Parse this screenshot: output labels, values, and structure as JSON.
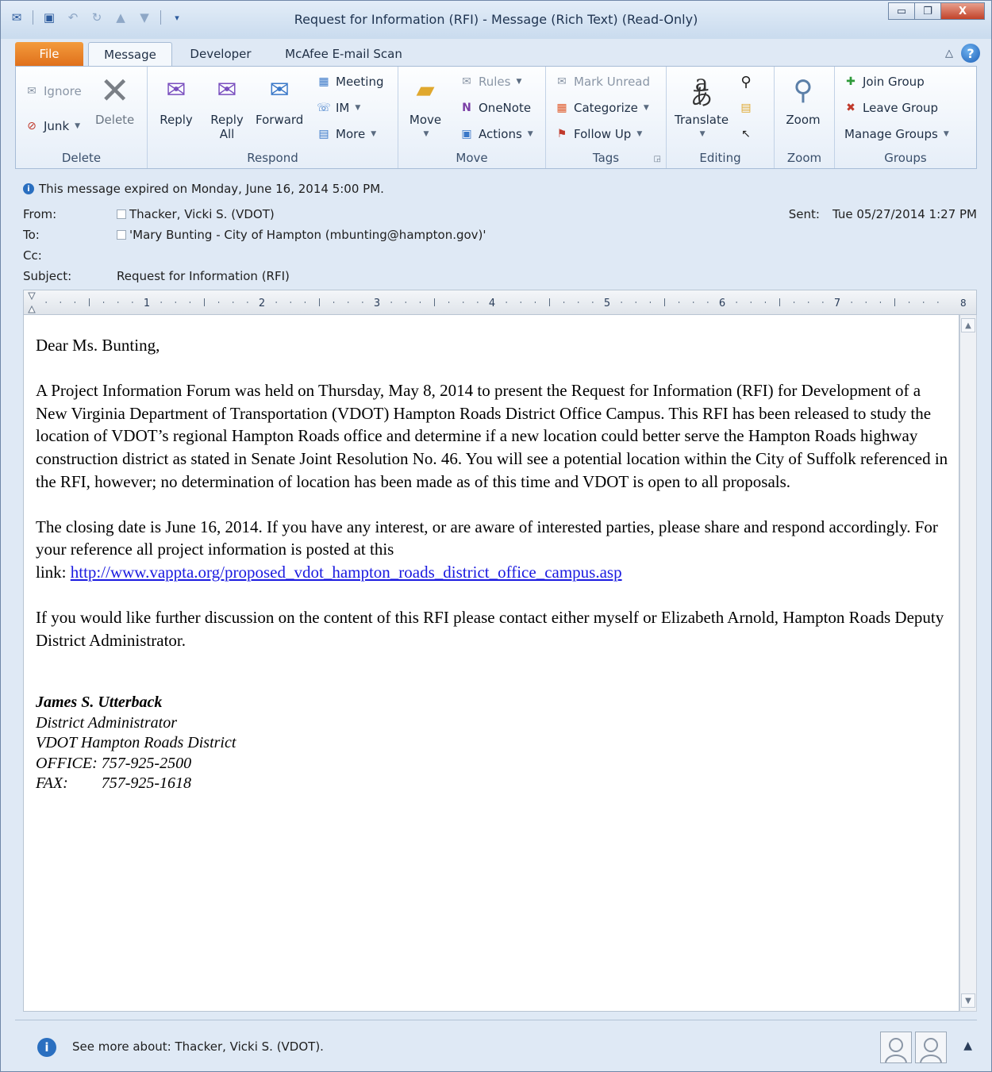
{
  "window": {
    "title": "Request for Information (RFI)  -  Message (Rich Text) (Read-Only)",
    "minimize": "▭",
    "restore": "❐",
    "close": "X"
  },
  "tabs": {
    "file": "File",
    "message": "Message",
    "developer": "Developer",
    "mcafee": "McAfee E-mail Scan",
    "help": "?"
  },
  "ribbon": {
    "delete_group": {
      "ignore": "Ignore",
      "junk": "Junk",
      "delete": "Delete",
      "label": "Delete"
    },
    "respond_group": {
      "reply": "Reply",
      "reply_all_1": "Reply",
      "reply_all_2": "All",
      "forward": "Forward",
      "meeting": "Meeting",
      "im": "IM",
      "more": "More",
      "label": "Respond"
    },
    "move_group": {
      "move": "Move",
      "rules": "Rules",
      "onenote": "OneNote",
      "actions": "Actions",
      "label": "Move"
    },
    "tags_group": {
      "mark_unread": "Mark Unread",
      "categorize": "Categorize",
      "follow_up": "Follow Up",
      "label": "Tags"
    },
    "editing_group": {
      "translate": "Translate",
      "label": "Editing"
    },
    "zoom_group": {
      "zoom": "Zoom",
      "label": "Zoom"
    },
    "groups_group": {
      "join": "Join Group",
      "leave": "Leave Group",
      "manage": "Manage Groups",
      "label": "Groups"
    }
  },
  "header": {
    "info": "This message expired on Monday, June 16, 2014 5:00 PM.",
    "from_label": "From:",
    "from_value": "Thacker, Vicki S. (VDOT)",
    "to_label": "To:",
    "to_value": "'Mary Bunting - City of Hampton (mbunting@hampton.gov)'",
    "cc_label": "Cc:",
    "subject_label": "Subject:",
    "subject_value": "Request for Information (RFI)",
    "sent_label": "Sent:",
    "sent_value": "Tue 05/27/2014 1:27 PM"
  },
  "ruler": {
    "marks": [
      "1",
      "2",
      "3",
      "4",
      "5",
      "6",
      "7"
    ],
    "end_mark": "8"
  },
  "body": {
    "greeting": "Dear Ms. Bunting,",
    "para1": "A Project Information Forum was held on Thursday, May 8, 2014 to present the Request for Information (RFI) for Development of a New Virginia Department of Transportation (VDOT) Hampton Roads District Office Campus.  This RFI has been released to study the location of VDOT’s regional Hampton Roads office and determine if a new location could better serve the Hampton Roads highway construction district as stated in Senate Joint Resolution No. 46.  You will see a potential location within the City of Suffolk referenced in the RFI, however; no determination of location has been made as of this time and VDOT is open to all proposals.",
    "para2": "The closing date is June 16, 2014.  If you have any interest, or are aware of interested parties, please share and respond accordingly.  For your reference all project information is posted at this",
    "link_prefix": "link:  ",
    "link": "http://www.vappta.org/proposed_vdot_hampton_roads_district_office_campus.asp",
    "para3": "If you would like further discussion on the content of this RFI please contact either myself or Elizabeth Arnold, Hampton Roads Deputy District Administrator.",
    "sig_name": "James S. Utterback",
    "sig_title": "District Administrator",
    "sig_org": "VDOT Hampton Roads District",
    "sig_office": "OFFICE:  757-925-2500",
    "sig_fax_label": "FAX:",
    "sig_fax_value": "757-925-1618"
  },
  "people_pane": {
    "text": "See more about: Thacker, Vicki S. (VDOT).",
    "info": "i",
    "collapse": "▲"
  },
  "colors": {
    "file_tab": "#e0701b",
    "link": "#1a1ae0",
    "info": "#2a6fc0"
  }
}
